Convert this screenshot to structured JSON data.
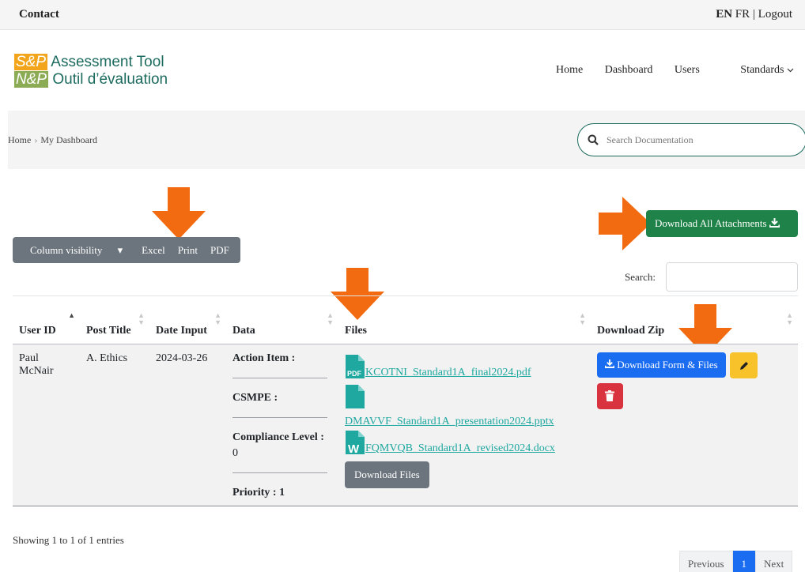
{
  "topbar": {
    "contact": "Contact",
    "lang_en": "EN",
    "lang_fr": "FR",
    "logout": "Logout"
  },
  "logo": {
    "abbr_en": "S&P",
    "name_en": "Assessment Tool",
    "abbr_fr": "N&P",
    "name_fr": "Outil d’évaluation"
  },
  "nav": {
    "home": "Home",
    "dashboard": "Dashboard",
    "users": "Users",
    "standards": "Standards"
  },
  "breadcrumb": {
    "home": "Home",
    "separator": "›",
    "current": "My Dashboard"
  },
  "search_doc": {
    "placeholder": "Search Documentation"
  },
  "toolbar": {
    "column_visibility": "Column visibility",
    "excel": "Excel",
    "print": "Print",
    "pdf": "PDF"
  },
  "download_all": {
    "label": "Download All Attachments"
  },
  "table_search": {
    "label": "Search:"
  },
  "table": {
    "headers": {
      "user_id": "User ID",
      "post_title": "Post Title",
      "date_input": "Date Input",
      "data": "Data",
      "files": "Files",
      "download_zip": "Download Zip"
    },
    "row": {
      "user_id": "Paul McNair",
      "post_title": "A. Ethics",
      "date_input": "2024-03-26",
      "data": {
        "action_item": "Action Item :",
        "csmpe": "CSMPE :",
        "compliance_label": "Compliance Level :",
        "compliance_value": "0",
        "priority": "Priority : 1"
      },
      "files": [
        {
          "name": "KCOTNI_Standard1A_final2024.pdf",
          "icon": "pdf-file-icon"
        },
        {
          "name": "DMAVVF_Standard1A_presentation2024.pptx",
          "icon": "file-icon"
        },
        {
          "name": "FQMVQB_Standard1A_revised2024.docx",
          "icon": "word-file-icon"
        }
      ],
      "download_files": "Download Files",
      "download_zip": "Download Form & Files"
    }
  },
  "footer": {
    "entries": "Showing 1 to 1 of 1 entries",
    "previous": "Previous",
    "page": "1",
    "next": "Next"
  },
  "colors": {
    "accent_green": "#1f8349",
    "primary_blue": "#1a6cf0",
    "warning": "#f7c22a",
    "danger": "#d8333f",
    "arrow": "#f26b10",
    "file_link": "#1ea8a0"
  }
}
